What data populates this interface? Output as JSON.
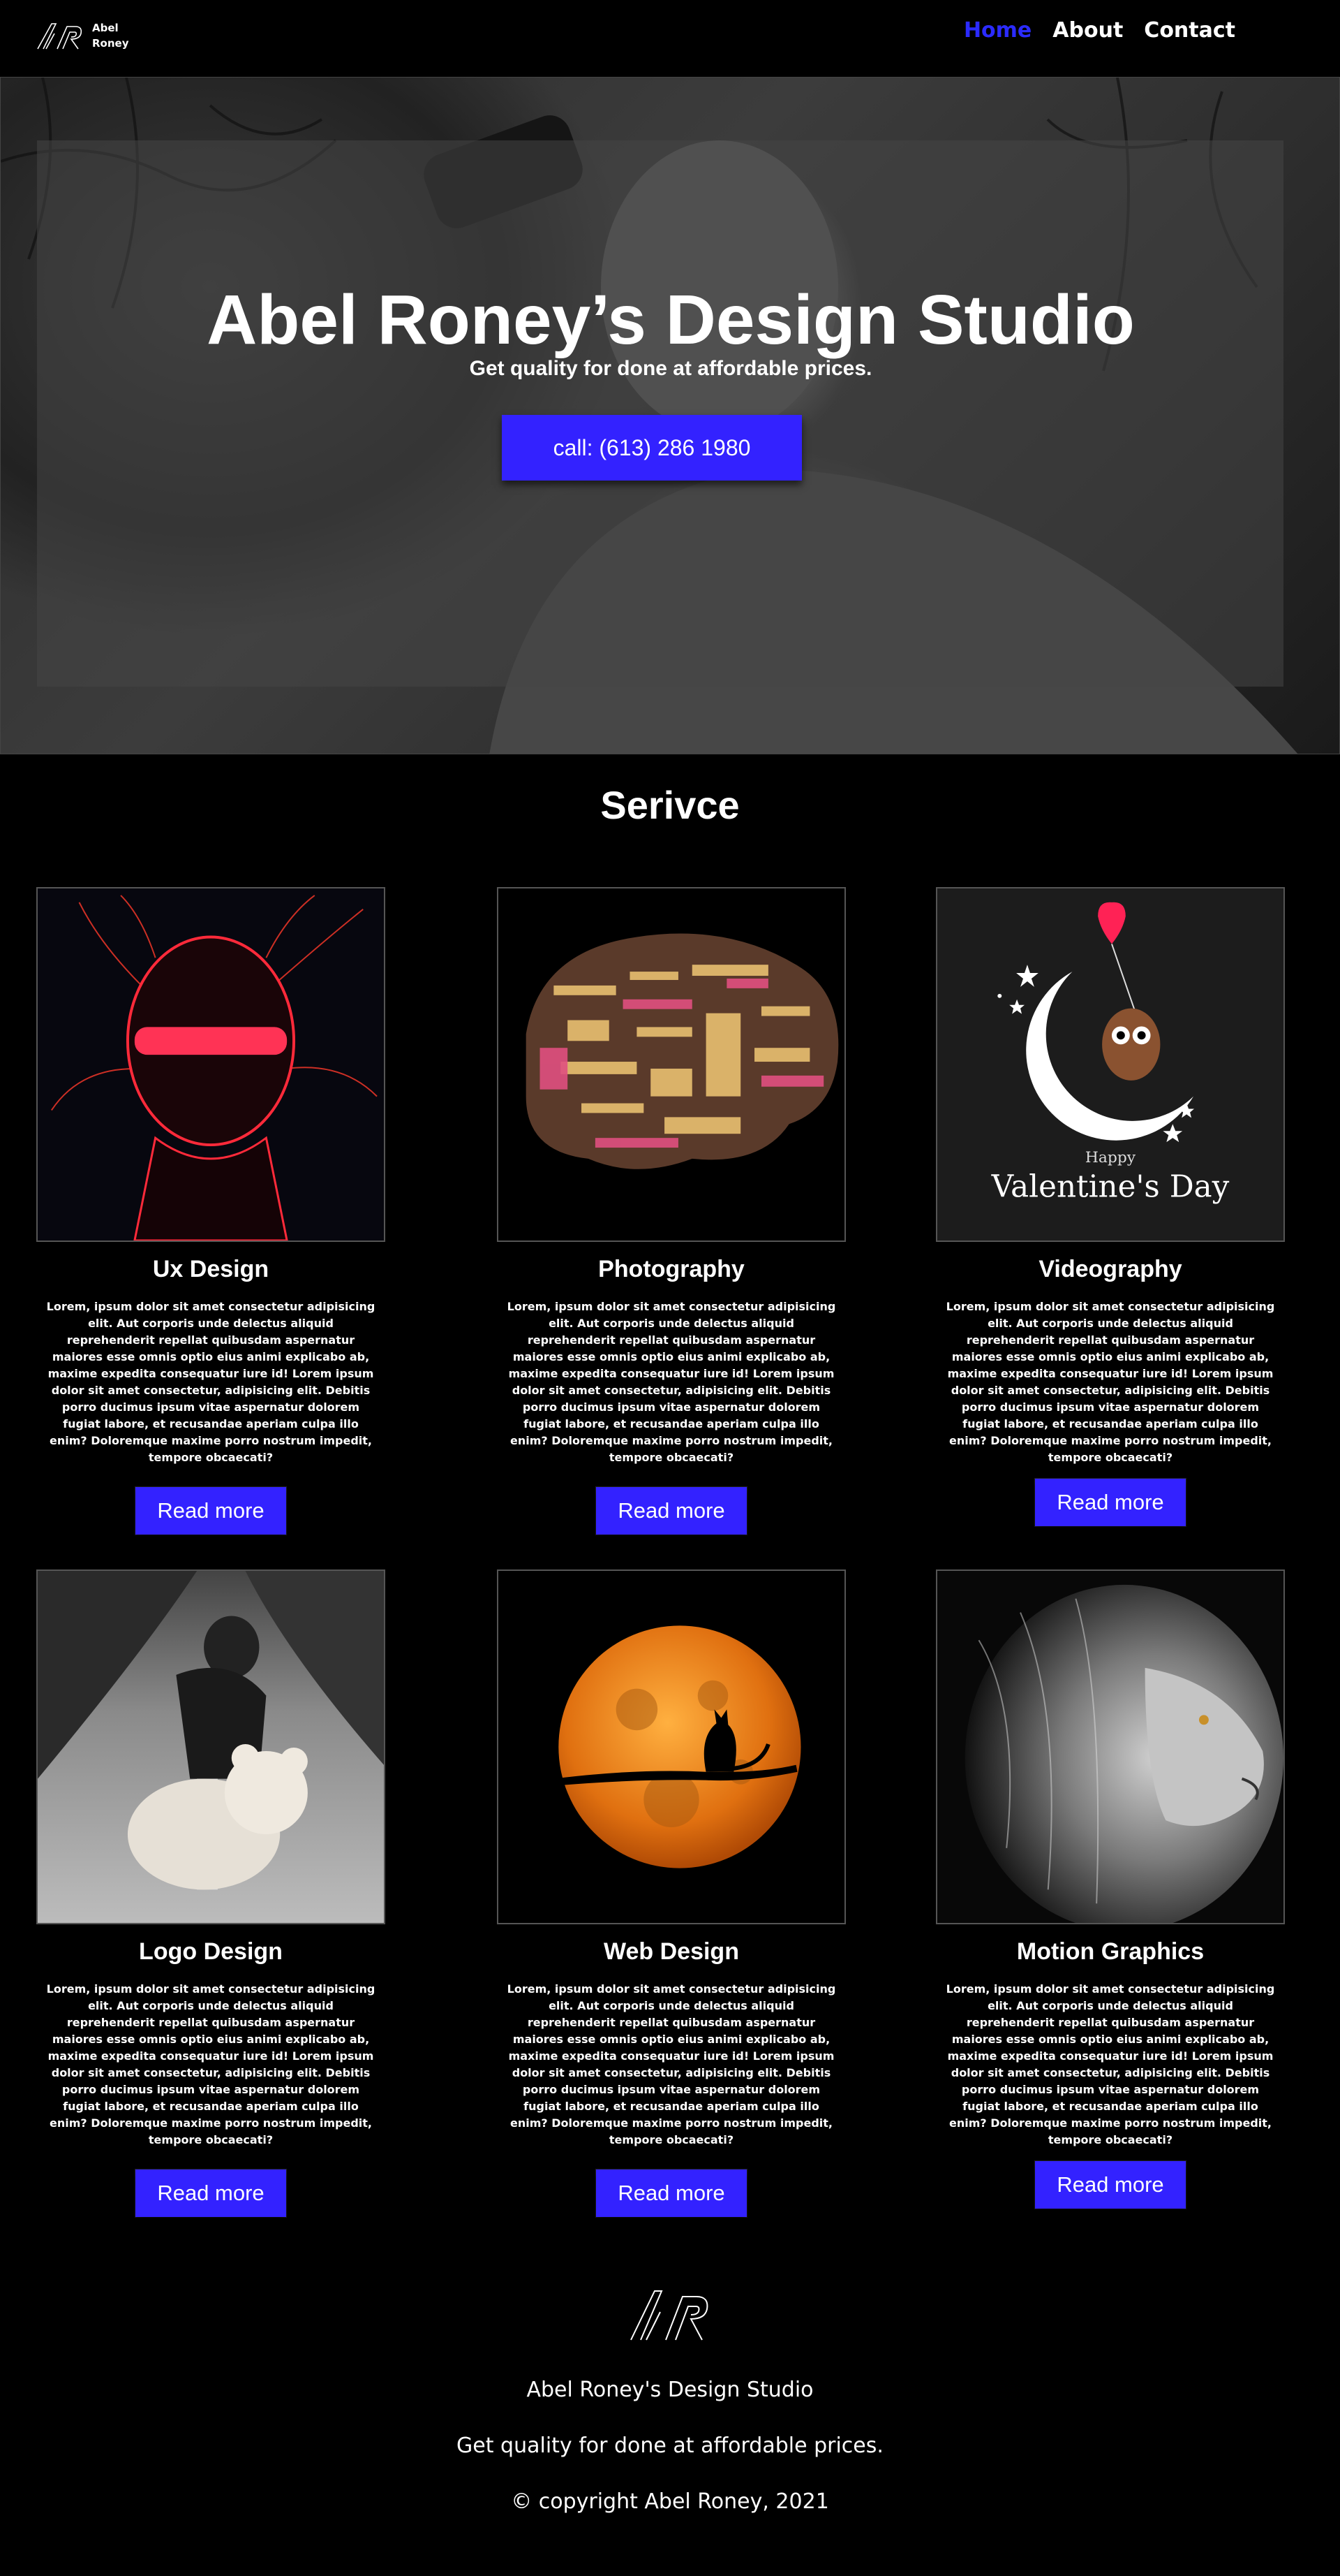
{
  "nav": {
    "logo_text": "Abel\nRoney",
    "links": [
      "Home",
      "About",
      "Contact"
    ]
  },
  "hero": {
    "title": "Abel Roney’s Design Studio",
    "subtitle": "Get quality for done at affordable prices.",
    "cta_label": "call: (613) 286 1980"
  },
  "services": {
    "title": "Serivce",
    "description": "Lorem, ipsum dolor sit amet consectetur adipisicing elit. Aut corporis unde delectus aliquid reprehenderit repellat quibusdam aspernatur maiores esse omnis optio eius animi explicabo ab, maxime expedita consequatur iure id! Lorem ipsum dolor sit amet consectetur, adipisicing elit. Debitis porro ducimus ipsum vitae aspernatur dolorem fugiat labore, et recusandae aperiam culpa illo enim? Doloremque maxime porro nostrum impedit, tempore obcaecati?",
    "button_label": "Read more",
    "items": [
      {
        "title": "Ux Design",
        "image": "neon-head-image"
      },
      {
        "title": "Photography",
        "image": "word-cloud-brain-image"
      },
      {
        "title": "Videography",
        "image": "valentines-owl-image",
        "image_caption_small": "Happy",
        "image_caption_large": "Valentine's Day"
      },
      {
        "title": "Logo Design",
        "image": "girl-teddy-bear-image"
      },
      {
        "title": "Web Design",
        "image": "moon-cat-image"
      },
      {
        "title": "Motion Graphics",
        "image": "lion-image"
      }
    ]
  },
  "footer": {
    "name": "Abel Roney's Design Studio",
    "tagline": "Get quality for done at affordable prices.",
    "copyright": "© copyright Abel Roney, 2021"
  },
  "colors": {
    "accent": "#3322ff",
    "active_nav": "#2b2bff",
    "background": "#000000"
  }
}
